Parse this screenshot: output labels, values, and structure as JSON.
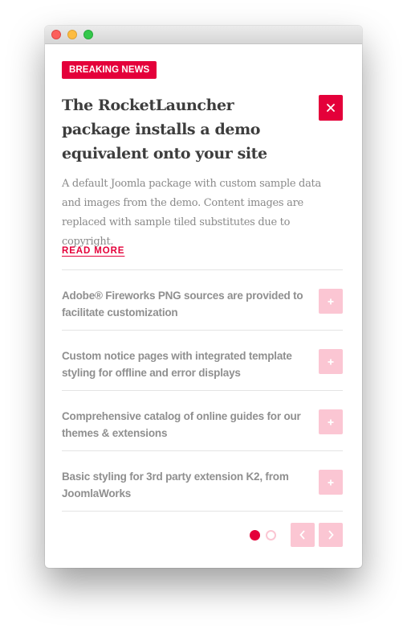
{
  "window": {
    "controls": [
      "close",
      "minimize",
      "zoom"
    ]
  },
  "article": {
    "badge": "BREAKING NEWS",
    "headline": "The RocketLauncher package installs a demo equivalent onto your site",
    "description": "A default Joomla package with custom sample data and images from the demo. Content images are replaced with sample tiled substitutes due to copyright.",
    "read_more": "READ MORE",
    "close_icon": "close-icon"
  },
  "list": {
    "items": [
      {
        "text": "Adobe® Fireworks PNG sources are provided to facilitate customization",
        "icon": "plus-icon"
      },
      {
        "text": "Custom notice pages with integrated template styling for offline and error displays",
        "icon": "plus-icon"
      },
      {
        "text": "Comprehensive catalog of online guides for our themes & extensions",
        "icon": "plus-icon"
      },
      {
        "text": "Basic styling for 3rd party extension K2, from JoomlaWorks",
        "icon": "plus-icon"
      }
    ]
  },
  "pagination": {
    "pages": 2,
    "current": 1,
    "prev_icon": "chevron-left-icon",
    "next_icon": "chevron-right-icon"
  },
  "colors": {
    "accent": "#e4003a",
    "accent_light": "#fbc6d3",
    "heading": "#3d3d3d",
    "body_text": "#8a8a8a",
    "divider": "#e4e4e4"
  }
}
